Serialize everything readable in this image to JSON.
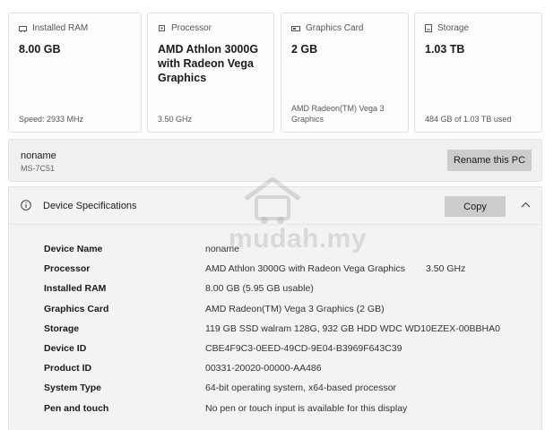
{
  "cards": [
    {
      "icon": "ram-icon",
      "label": "Installed RAM",
      "value": "8.00 GB",
      "footer": "Speed: 2933 MHz"
    },
    {
      "icon": "processor-icon",
      "label": "Processor",
      "value": "AMD Athlon 3000G with Radeon Vega Graphics",
      "footer": "3.50 GHz"
    },
    {
      "icon": "graphics-card-icon",
      "label": "Graphics Card",
      "value": "2 GB",
      "footer": "AMD Radeon(TM) Vega 3 Graphics"
    },
    {
      "icon": "storage-icon",
      "label": "Storage",
      "value": "1.03 TB",
      "footer": "484 GB of 1.03 TB used"
    }
  ],
  "pc": {
    "name": "noname",
    "model": "MS-7C51",
    "rename_label": "Rename this PC"
  },
  "specs": {
    "title": "Device Specifications",
    "copy_label": "Copy",
    "rows": [
      {
        "label": "Device Name",
        "value": "noname",
        "extra": ""
      },
      {
        "label": "Processor",
        "value": "AMD Athlon 3000G with Radeon Vega Graphics",
        "extra": "3.50 GHz"
      },
      {
        "label": "Installed RAM",
        "value": "8.00 GB (5.95 GB usable)",
        "extra": ""
      },
      {
        "label": "Graphics Card",
        "value": "AMD Radeon(TM) Vega 3 Graphics (2 GB)",
        "extra": ""
      },
      {
        "label": "Storage",
        "value": "119 GB SSD walram 128G, 932 GB HDD WDC WD10EZEX-00BBHA0",
        "extra": ""
      },
      {
        "label": "Device ID",
        "value": "CBE4F9C3-0EED-49CD-9E04-B3969F643C39",
        "extra": ""
      },
      {
        "label": "Product ID",
        "value": "00331-20020-00000-AA486",
        "extra": ""
      },
      {
        "label": "System Type",
        "value": "64-bit operating system, x64-based processor",
        "extra": ""
      },
      {
        "label": "Pen and touch",
        "value": "No pen or touch input is available for this display",
        "extra": ""
      }
    ]
  },
  "watermark": {
    "text": "mudah.my"
  },
  "colors": {
    "button": "#cccccc",
    "panel": "#f3f3f3",
    "card_border": "#e0e0e0"
  }
}
